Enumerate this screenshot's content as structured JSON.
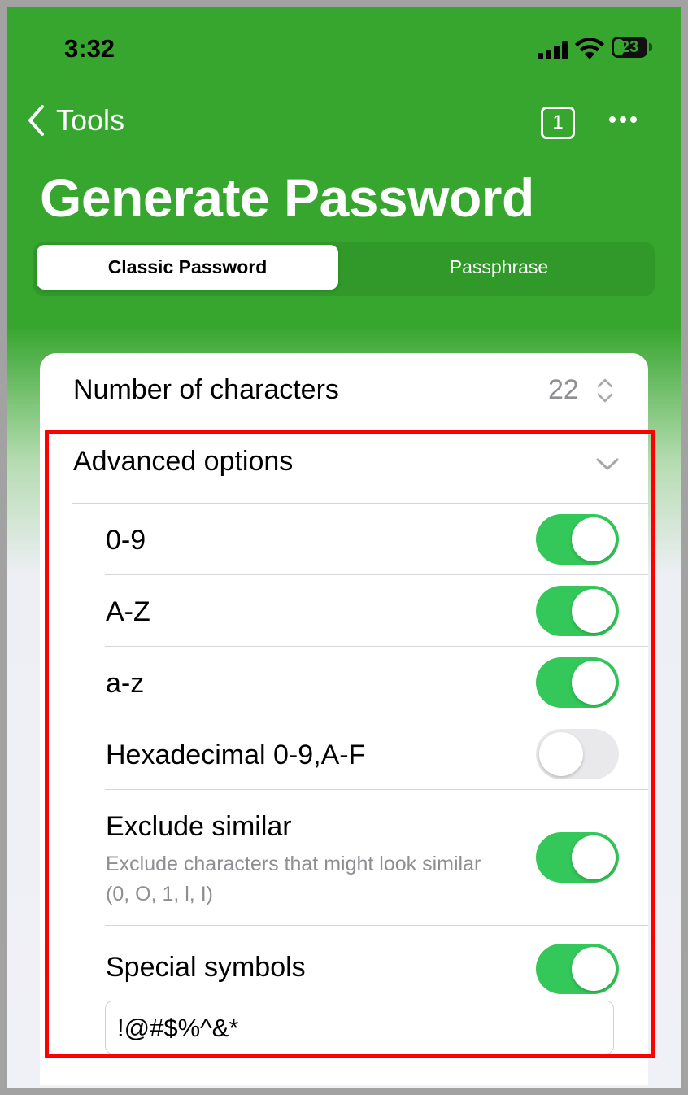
{
  "status_bar": {
    "time": "3:32",
    "battery_level": "23",
    "icons": [
      "cellular-signal-icon",
      "wifi-icon",
      "battery-icon"
    ]
  },
  "nav": {
    "back_label": "Tools",
    "back_icon": "chevron-left-icon",
    "tab_count": "1",
    "more_icon": "ellipsis-icon"
  },
  "page_title": "Generate Password",
  "segments": {
    "active": "Classic Password",
    "inactive": "Passphrase"
  },
  "settings": {
    "number_of_characters": {
      "label": "Number of characters",
      "value": "22",
      "icon": "stepper-icon"
    },
    "advanced_options": {
      "label": "Advanced options",
      "expanded": true,
      "icon": "chevron-down-icon"
    },
    "options": [
      {
        "label": "0-9",
        "enabled": true
      },
      {
        "label": "A-Z",
        "enabled": true
      },
      {
        "label": "a-z",
        "enabled": true
      },
      {
        "label": "Hexadecimal 0-9,A-F",
        "enabled": false
      },
      {
        "label": "Exclude similar",
        "description": "Exclude characters that might look similar (0, O, 1, l, I)",
        "enabled": true
      },
      {
        "label": "Special symbols",
        "enabled": true
      }
    ],
    "special_symbols_value": "!@#$%^&*"
  },
  "colors": {
    "header_green": "#36a62e",
    "toggle_on": "#34c759",
    "toggle_off": "#e9e9eb",
    "highlight": "#ff0000"
  }
}
